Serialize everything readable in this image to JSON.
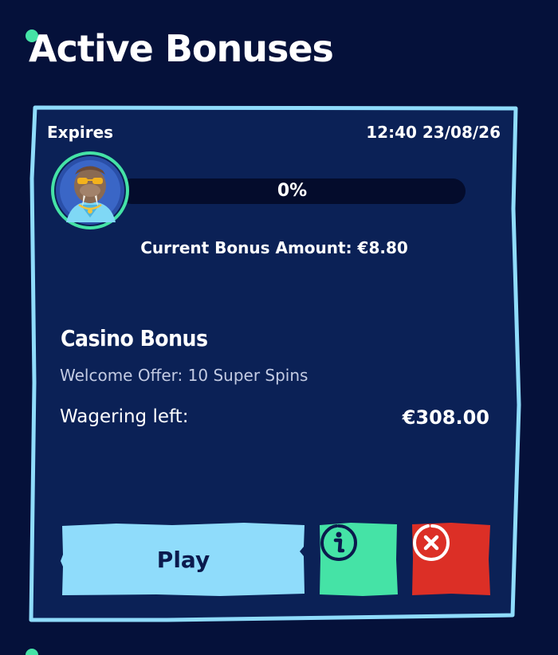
{
  "page": {
    "title": "Active Bonuses"
  },
  "bonus_card": {
    "expires_label": "Expires",
    "expires_value": "12:40 23/08/26",
    "progress_text": "0%",
    "progress_fraction": 0,
    "current_amount_text": "Current Bonus Amount: €8.80",
    "bonus_title": "Casino Bonus",
    "bonus_subtitle": "Welcome Offer: 10 Super Spins",
    "wagering_label": "Wagering left:",
    "wagering_value": "€308.00",
    "avatar_icon": "walrus-character-icon",
    "buttons": {
      "play_label": "Play",
      "info_icon": "info-icon",
      "cancel_icon": "close-circle-icon"
    }
  },
  "colors": {
    "background": "#05113a",
    "card": "#0b2156",
    "card_border": "#8fdcfb",
    "accent_green": "#45e3a6",
    "play_button": "#8fdcfb",
    "cancel_button": "#dc2f26"
  }
}
